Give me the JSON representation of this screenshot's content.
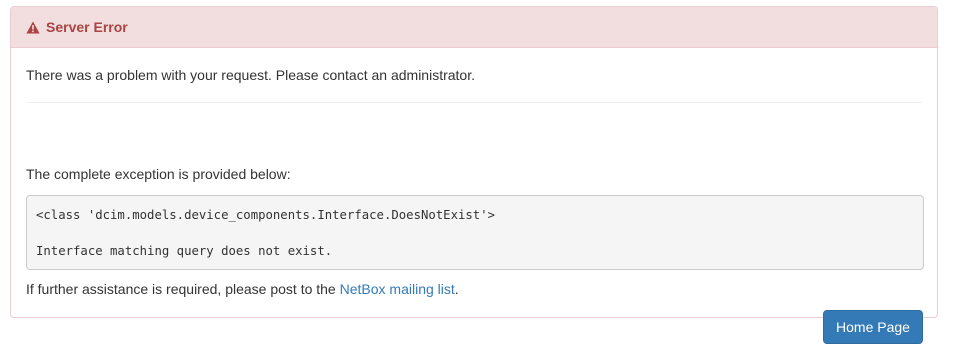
{
  "panel": {
    "title": "Server Error",
    "icon": "warning-icon",
    "colors": {
      "heading_bg": "#f2dede",
      "heading_text": "#a94442",
      "border": "#ebccd1",
      "link": "#337ab7",
      "button": "#337ab7"
    }
  },
  "body": {
    "message": "There was a problem with your request. Please contact an administrator.",
    "exception_label": "The complete exception is provided below:",
    "exception_lines": [
      "<class 'dcim.models.device_components.Interface.DoesNotExist'>",
      "Interface matching query does not exist."
    ],
    "assistance_prefix": "If further assistance is required, please post to the ",
    "assistance_link": "NetBox mailing list",
    "assistance_suffix": "."
  },
  "actions": {
    "home_button": "Home Page"
  }
}
